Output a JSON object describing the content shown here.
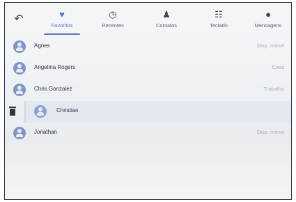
{
  "tabs": [
    {
      "label": "Favoritos",
      "icon": "heart-icon",
      "active": true
    },
    {
      "label": "Recentes",
      "icon": "clock-icon",
      "active": false
    },
    {
      "label": "Contatos",
      "icon": "person-icon",
      "active": false
    },
    {
      "label": "Teclado",
      "icon": "dialpad-icon",
      "active": false
    },
    {
      "label": "Mensagens",
      "icon": "message-icon",
      "active": false
    }
  ],
  "contacts": [
    {
      "name": "Agnes",
      "type": "Disp. móvel"
    },
    {
      "name": "Angelina Rogers",
      "type": "Casa"
    },
    {
      "name": "Chris Gonzalez",
      "type": "Trabalho"
    },
    {
      "name": "Christian",
      "type": ""
    },
    {
      "name": "Jonathan",
      "type": "Disp. móvel"
    }
  ],
  "colors": {
    "accent": "#5a73c8",
    "avatar": "#7f95c9"
  }
}
